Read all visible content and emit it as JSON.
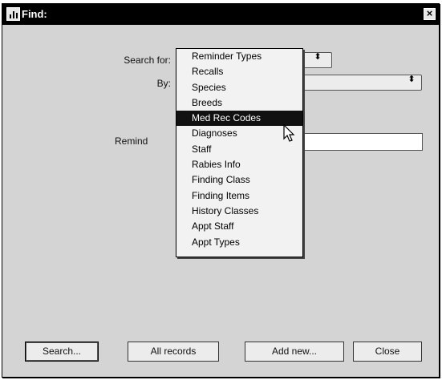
{
  "window": {
    "title": "Find:",
    "close_label": "×"
  },
  "form": {
    "search_for_label": "Search for:",
    "by_label": "By:",
    "reminder_label": "Remind",
    "reminder_value": "",
    "stepper_symbol": "⬍"
  },
  "dropdown": {
    "options": [
      "Reminder Types",
      "Recalls",
      "Species",
      "Breeds",
      "Med Rec Codes",
      "Diagnoses",
      "Staff",
      "Rabies Info",
      "Finding Class",
      "Finding Items",
      "History Classes",
      "Appt Staff",
      "Appt Types"
    ],
    "highlighted": "Med Rec Codes"
  },
  "buttons": {
    "search": "Search...",
    "all_records": "All records",
    "add_new": "Add new...",
    "close": "Close"
  },
  "icons": {
    "window_icon": "chart-icon",
    "cursor": "mouse-pointer-icon"
  }
}
